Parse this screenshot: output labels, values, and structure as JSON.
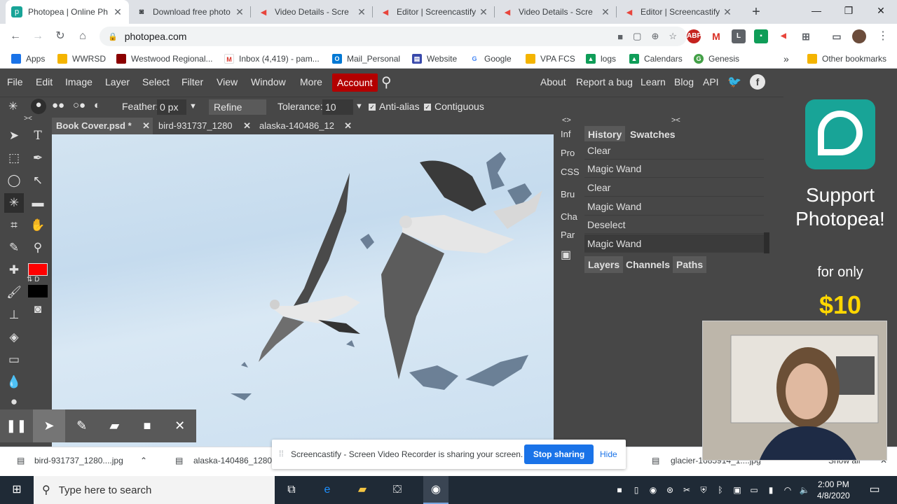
{
  "browser": {
    "tabs": [
      {
        "title": "Photopea | Online Ph",
        "active": true
      },
      {
        "title": "Download free photo",
        "active": false
      },
      {
        "title": "Video Details - Scre",
        "active": false
      },
      {
        "title": "Editor | Screencastify",
        "active": false
      },
      {
        "title": "Video Details - Scre",
        "active": false
      },
      {
        "title": "Editor | Screencastify",
        "active": false
      }
    ],
    "url": "photopea.com",
    "bookmarks": [
      "Apps",
      "WWRSD",
      "Westwood Regional...",
      "Inbox (4,419) - pam...",
      "Mail_Personal",
      "Website",
      "Google",
      "VPA FCS",
      "logs",
      "Calendars",
      "Genesis"
    ],
    "other_bookmarks": "Other bookmarks",
    "extension_badge": "ABP"
  },
  "photopea": {
    "menu": [
      "File",
      "Edit",
      "Image",
      "Layer",
      "Select",
      "Filter",
      "View",
      "Window",
      "More"
    ],
    "account": "Account",
    "right_links": [
      "About",
      "Report a bug",
      "Learn",
      "Blog",
      "API"
    ],
    "options": {
      "feather_label": "Feather:",
      "feather_value": "0 px",
      "refine_edge": "Refine Edge",
      "tolerance_label": "Tolerance:",
      "tolerance_value": "10",
      "anti_alias": "Anti-alias",
      "contiguous": "Contiguous"
    },
    "doc_tabs": [
      "Book Cover.psd *",
      "bird-931737_1280",
      "alaska-140486_12"
    ],
    "side_icons": [
      "Inf",
      "Pro",
      "CSS",
      "Bru",
      "Cha",
      "Par"
    ],
    "panel_tabs_top": [
      "History",
      "Swatches"
    ],
    "history": [
      "Clear",
      "Magic Wand",
      "Clear",
      "Magic Wand",
      "Deselect",
      "Magic Wand"
    ],
    "panel_tabs_bottom": [
      "Layers",
      "Channels",
      "Paths"
    ],
    "ad": {
      "line1": "Support",
      "line2": "Photopea!",
      "line3": "for only",
      "line4": "$10"
    },
    "colors": {
      "foreground": "#ff0000",
      "background": "#000000",
      "accent": "#b30000"
    }
  },
  "downloads": {
    "items": [
      "bird-931737_1280....jpg",
      "alaska-140486_1280.j",
      "glacier-1685914_1....jpg"
    ],
    "show_all": "Show all"
  },
  "share_banner": {
    "message": "Screencastify - Screen Video Recorder is sharing your screen.",
    "stop": "Stop sharing",
    "hide": "Hide"
  },
  "taskbar": {
    "search_placeholder": "Type here to search",
    "time": "2:00 PM",
    "date": "4/8/2020"
  }
}
